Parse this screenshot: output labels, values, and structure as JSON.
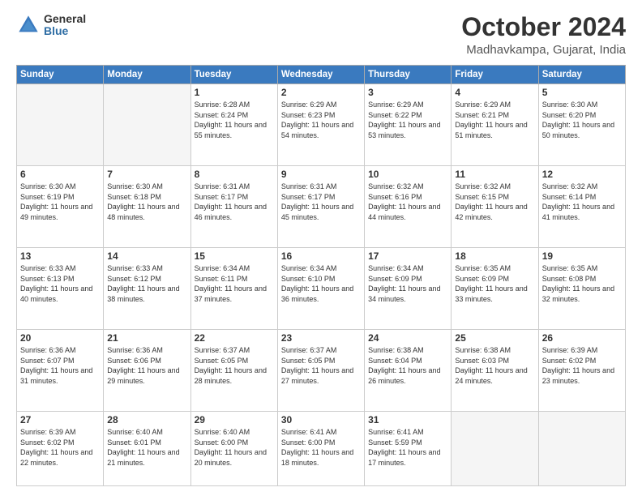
{
  "logo": {
    "general": "General",
    "blue": "Blue"
  },
  "header": {
    "month": "October 2024",
    "location": "Madhavkampa, Gujarat, India"
  },
  "weekdays": [
    "Sunday",
    "Monday",
    "Tuesday",
    "Wednesday",
    "Thursday",
    "Friday",
    "Saturday"
  ],
  "weeks": [
    [
      {
        "day": "",
        "sunrise": "",
        "sunset": "",
        "daylight": "",
        "empty": true
      },
      {
        "day": "",
        "sunrise": "",
        "sunset": "",
        "daylight": "",
        "empty": true
      },
      {
        "day": "1",
        "sunrise": "Sunrise: 6:28 AM",
        "sunset": "Sunset: 6:24 PM",
        "daylight": "Daylight: 11 hours and 55 minutes.",
        "empty": false
      },
      {
        "day": "2",
        "sunrise": "Sunrise: 6:29 AM",
        "sunset": "Sunset: 6:23 PM",
        "daylight": "Daylight: 11 hours and 54 minutes.",
        "empty": false
      },
      {
        "day": "3",
        "sunrise": "Sunrise: 6:29 AM",
        "sunset": "Sunset: 6:22 PM",
        "daylight": "Daylight: 11 hours and 53 minutes.",
        "empty": false
      },
      {
        "day": "4",
        "sunrise": "Sunrise: 6:29 AM",
        "sunset": "Sunset: 6:21 PM",
        "daylight": "Daylight: 11 hours and 51 minutes.",
        "empty": false
      },
      {
        "day": "5",
        "sunrise": "Sunrise: 6:30 AM",
        "sunset": "Sunset: 6:20 PM",
        "daylight": "Daylight: 11 hours and 50 minutes.",
        "empty": false
      }
    ],
    [
      {
        "day": "6",
        "sunrise": "Sunrise: 6:30 AM",
        "sunset": "Sunset: 6:19 PM",
        "daylight": "Daylight: 11 hours and 49 minutes.",
        "empty": false
      },
      {
        "day": "7",
        "sunrise": "Sunrise: 6:30 AM",
        "sunset": "Sunset: 6:18 PM",
        "daylight": "Daylight: 11 hours and 48 minutes.",
        "empty": false
      },
      {
        "day": "8",
        "sunrise": "Sunrise: 6:31 AM",
        "sunset": "Sunset: 6:17 PM",
        "daylight": "Daylight: 11 hours and 46 minutes.",
        "empty": false
      },
      {
        "day": "9",
        "sunrise": "Sunrise: 6:31 AM",
        "sunset": "Sunset: 6:17 PM",
        "daylight": "Daylight: 11 hours and 45 minutes.",
        "empty": false
      },
      {
        "day": "10",
        "sunrise": "Sunrise: 6:32 AM",
        "sunset": "Sunset: 6:16 PM",
        "daylight": "Daylight: 11 hours and 44 minutes.",
        "empty": false
      },
      {
        "day": "11",
        "sunrise": "Sunrise: 6:32 AM",
        "sunset": "Sunset: 6:15 PM",
        "daylight": "Daylight: 11 hours and 42 minutes.",
        "empty": false
      },
      {
        "day": "12",
        "sunrise": "Sunrise: 6:32 AM",
        "sunset": "Sunset: 6:14 PM",
        "daylight": "Daylight: 11 hours and 41 minutes.",
        "empty": false
      }
    ],
    [
      {
        "day": "13",
        "sunrise": "Sunrise: 6:33 AM",
        "sunset": "Sunset: 6:13 PM",
        "daylight": "Daylight: 11 hours and 40 minutes.",
        "empty": false
      },
      {
        "day": "14",
        "sunrise": "Sunrise: 6:33 AM",
        "sunset": "Sunset: 6:12 PM",
        "daylight": "Daylight: 11 hours and 38 minutes.",
        "empty": false
      },
      {
        "day": "15",
        "sunrise": "Sunrise: 6:34 AM",
        "sunset": "Sunset: 6:11 PM",
        "daylight": "Daylight: 11 hours and 37 minutes.",
        "empty": false
      },
      {
        "day": "16",
        "sunrise": "Sunrise: 6:34 AM",
        "sunset": "Sunset: 6:10 PM",
        "daylight": "Daylight: 11 hours and 36 minutes.",
        "empty": false
      },
      {
        "day": "17",
        "sunrise": "Sunrise: 6:34 AM",
        "sunset": "Sunset: 6:09 PM",
        "daylight": "Daylight: 11 hours and 34 minutes.",
        "empty": false
      },
      {
        "day": "18",
        "sunrise": "Sunrise: 6:35 AM",
        "sunset": "Sunset: 6:09 PM",
        "daylight": "Daylight: 11 hours and 33 minutes.",
        "empty": false
      },
      {
        "day": "19",
        "sunrise": "Sunrise: 6:35 AM",
        "sunset": "Sunset: 6:08 PM",
        "daylight": "Daylight: 11 hours and 32 minutes.",
        "empty": false
      }
    ],
    [
      {
        "day": "20",
        "sunrise": "Sunrise: 6:36 AM",
        "sunset": "Sunset: 6:07 PM",
        "daylight": "Daylight: 11 hours and 31 minutes.",
        "empty": false
      },
      {
        "day": "21",
        "sunrise": "Sunrise: 6:36 AM",
        "sunset": "Sunset: 6:06 PM",
        "daylight": "Daylight: 11 hours and 29 minutes.",
        "empty": false
      },
      {
        "day": "22",
        "sunrise": "Sunrise: 6:37 AM",
        "sunset": "Sunset: 6:05 PM",
        "daylight": "Daylight: 11 hours and 28 minutes.",
        "empty": false
      },
      {
        "day": "23",
        "sunrise": "Sunrise: 6:37 AM",
        "sunset": "Sunset: 6:05 PM",
        "daylight": "Daylight: 11 hours and 27 minutes.",
        "empty": false
      },
      {
        "day": "24",
        "sunrise": "Sunrise: 6:38 AM",
        "sunset": "Sunset: 6:04 PM",
        "daylight": "Daylight: 11 hours and 26 minutes.",
        "empty": false
      },
      {
        "day": "25",
        "sunrise": "Sunrise: 6:38 AM",
        "sunset": "Sunset: 6:03 PM",
        "daylight": "Daylight: 11 hours and 24 minutes.",
        "empty": false
      },
      {
        "day": "26",
        "sunrise": "Sunrise: 6:39 AM",
        "sunset": "Sunset: 6:02 PM",
        "daylight": "Daylight: 11 hours and 23 minutes.",
        "empty": false
      }
    ],
    [
      {
        "day": "27",
        "sunrise": "Sunrise: 6:39 AM",
        "sunset": "Sunset: 6:02 PM",
        "daylight": "Daylight: 11 hours and 22 minutes.",
        "empty": false
      },
      {
        "day": "28",
        "sunrise": "Sunrise: 6:40 AM",
        "sunset": "Sunset: 6:01 PM",
        "daylight": "Daylight: 11 hours and 21 minutes.",
        "empty": false
      },
      {
        "day": "29",
        "sunrise": "Sunrise: 6:40 AM",
        "sunset": "Sunset: 6:00 PM",
        "daylight": "Daylight: 11 hours and 20 minutes.",
        "empty": false
      },
      {
        "day": "30",
        "sunrise": "Sunrise: 6:41 AM",
        "sunset": "Sunset: 6:00 PM",
        "daylight": "Daylight: 11 hours and 18 minutes.",
        "empty": false
      },
      {
        "day": "31",
        "sunrise": "Sunrise: 6:41 AM",
        "sunset": "Sunset: 5:59 PM",
        "daylight": "Daylight: 11 hours and 17 minutes.",
        "empty": false
      },
      {
        "day": "",
        "sunrise": "",
        "sunset": "",
        "daylight": "",
        "empty": true
      },
      {
        "day": "",
        "sunrise": "",
        "sunset": "",
        "daylight": "",
        "empty": true
      }
    ]
  ]
}
